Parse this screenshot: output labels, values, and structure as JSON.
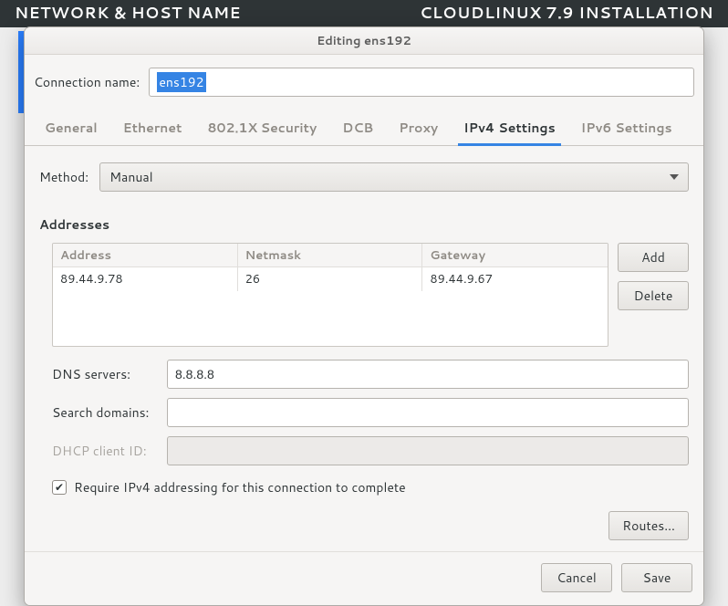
{
  "header": {
    "left": "NETWORK & HOST NAME",
    "right": "CLOUDLINUX 7.9 INSTALLATION"
  },
  "dialog": {
    "title": "Editing ens192",
    "connection_name_label": "Connection name:",
    "connection_name_value": "ens192",
    "tabs": {
      "general": "General",
      "ethernet": "Ethernet",
      "security": "802.1X Security",
      "dcb": "DCB",
      "proxy": "Proxy",
      "ipv4": "IPv4 Settings",
      "ipv6": "IPv6 Settings"
    },
    "active_tab": "ipv4",
    "method_label": "Method:",
    "method_value": "Manual",
    "addresses_label": "Addresses",
    "addresses_columns": {
      "address": "Address",
      "netmask": "Netmask",
      "gateway": "Gateway"
    },
    "addresses_rows": [
      {
        "address": "89.44.9.78",
        "netmask": "26",
        "gateway": "89.44.9.67"
      }
    ],
    "add_label": "Add",
    "delete_label": "Delete",
    "dns_label": "DNS servers:",
    "dns_value": "8.8.8.8",
    "search_domains_label": "Search domains:",
    "search_domains_value": "",
    "dhcp_client_id_label": "DHCP client ID:",
    "dhcp_client_id_value": "",
    "require_ipv4_label": "Require IPv4 addressing for this connection to complete",
    "require_ipv4_checked": true,
    "routes_label": "Routes…",
    "cancel_label": "Cancel",
    "save_label": "Save"
  }
}
